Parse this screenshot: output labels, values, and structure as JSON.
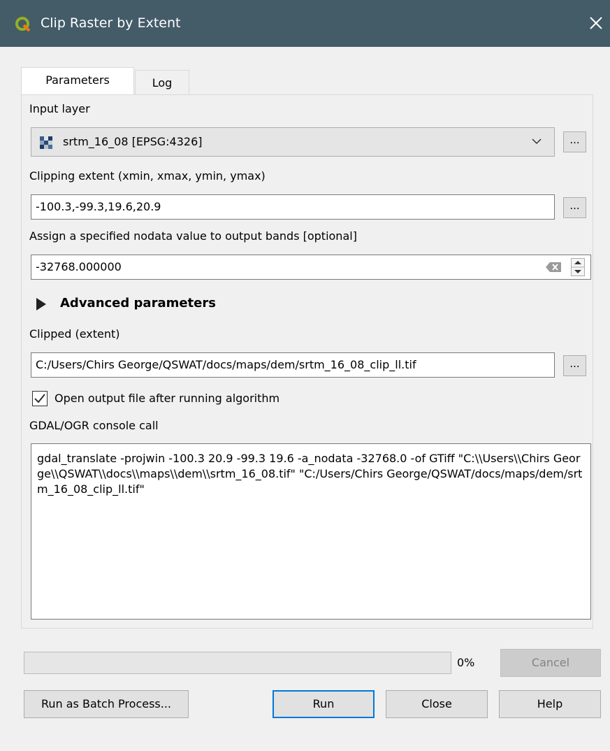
{
  "window": {
    "title": "Clip Raster by Extent"
  },
  "tabs": [
    {
      "label": "Parameters"
    },
    {
      "label": "Log"
    }
  ],
  "params": {
    "input_layer_label": "Input layer",
    "input_layer_value": "srtm_16_08 [EPSG:4326]",
    "extent_label": "Clipping extent (xmin, xmax, ymin, ymax)",
    "extent_value": "-100.3,-99.3,19.6,20.9",
    "nodata_label": "Assign a specified nodata value to output bands [optional]",
    "nodata_value": "-32768.000000",
    "advanced_label": "Advanced parameters",
    "output_label": "Clipped (extent)",
    "output_value": "C:/Users/Chirs George/QSWAT/docs/maps/dem/srtm_16_08_clip_ll.tif",
    "open_output_label": "Open output file after running algorithm",
    "open_output_checked": true,
    "console_label": "GDAL/OGR console call",
    "console_text": "gdal_translate -projwin -100.3 20.9 -99.3 19.6 -a_nodata -32768.0 -of GTiff \"C:\\\\Users\\\\Chirs George\\\\QSWAT\\\\docs\\\\maps\\\\dem\\\\srtm_16_08.tif\" \"C:/Users/Chirs George/QSWAT/docs/maps/dem/srtm_16_08_clip_ll.tif\"",
    "dots": "..."
  },
  "progress": {
    "value": 0,
    "label": "0%"
  },
  "buttons": {
    "cancel": "Cancel",
    "batch": "Run as Batch Process...",
    "run": "Run",
    "close": "Close",
    "help": "Help"
  },
  "icons": {
    "app": "qgis-logo-icon",
    "close": "close-icon",
    "layer": "raster-layer-icon",
    "dropdown": "chevron-down-icon",
    "clear": "clear-icon",
    "spin": "spinner-arrows-icon",
    "expand": "triangle-right-icon",
    "check": "checkmark-icon"
  },
  "colors": {
    "titlebar": "#445b68",
    "accent": "#0078d7",
    "logo_green": "#589632"
  }
}
